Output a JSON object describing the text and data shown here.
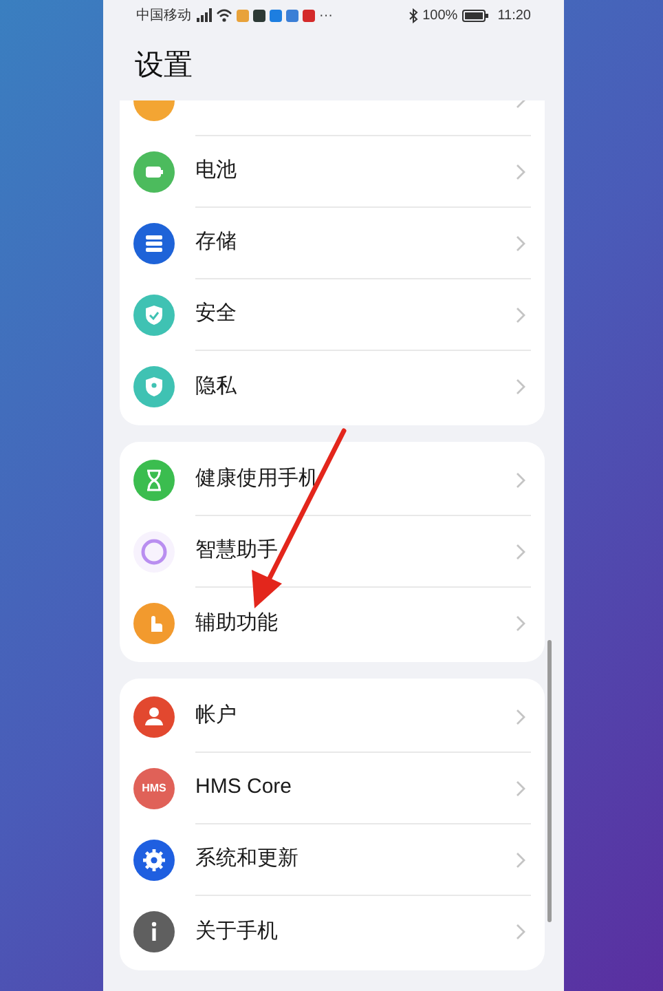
{
  "status_bar": {
    "carrier": "中国移动",
    "more": "···",
    "battery": "100%",
    "time": "11:20"
  },
  "title": "设置",
  "groups": [
    {
      "items": [
        {
          "color": "#f3a533",
          "partial": true
        },
        {
          "label": "电池",
          "color": "#4cbb5d"
        },
        {
          "label": "存储",
          "color": "#1e63d8"
        },
        {
          "label": "安全",
          "color": "#3fc2b3"
        },
        {
          "label": "隐私",
          "color": "#3fc2b3"
        }
      ]
    },
    {
      "items": [
        {
          "label": "健康使用手机",
          "color": "#3bbd4f"
        },
        {
          "label": "智慧助手",
          "color": "#b98ef0"
        },
        {
          "label": "辅助功能",
          "color": "#f29a2e"
        }
      ]
    },
    {
      "items": [
        {
          "label": "帐户",
          "color": "#e2482f"
        },
        {
          "label": "HMS Core",
          "color": "#e06158",
          "icon_text": "HMS"
        },
        {
          "label": "系统和更新",
          "color": "#1f5fe0"
        },
        {
          "label": "关于手机",
          "color": "#5f5f5f"
        }
      ]
    }
  ]
}
